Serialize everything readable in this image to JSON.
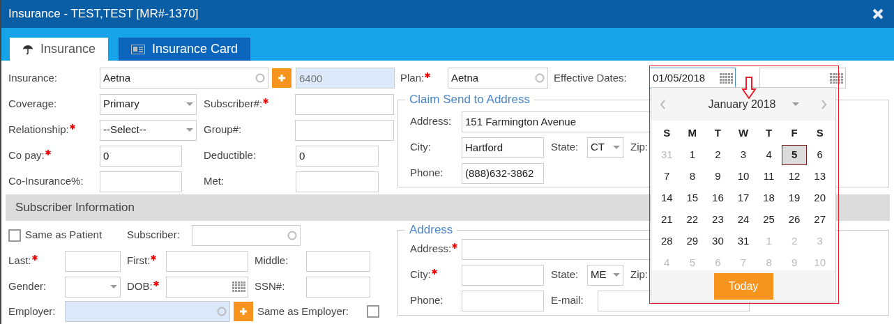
{
  "window": {
    "title": "Insurance - TEST,TEST [MR#-1370]"
  },
  "tabs": [
    {
      "label": "Insurance",
      "kind": "umbrella",
      "selected": true
    },
    {
      "label": "Insurance Card",
      "kind": "card",
      "selected": false
    }
  ],
  "top_row": {
    "insurance": {
      "label": "Insurance:",
      "kind": "lookup",
      "value": "Aetna"
    },
    "code": {
      "kind": "text",
      "value": "6400",
      "highlighted": true
    },
    "plan": {
      "label": "Plan:",
      "required": true,
      "kind": "lookup",
      "value": "Aetna"
    },
    "effective_dates": {
      "label": "Effective Dates:",
      "from": "01/05/2018"
    }
  },
  "policy_fields": [
    [
      {
        "label": "Coverage:",
        "required": false,
        "kind": "select",
        "value": "Primary"
      },
      {
        "label": "Subscriber#:",
        "required": true,
        "kind": "text"
      }
    ],
    [
      {
        "label": "Relationship:",
        "required": true,
        "kind": "select",
        "value": "--Select--"
      },
      {
        "label": "Group#:",
        "required": false,
        "kind": "text"
      }
    ],
    [
      {
        "label": "Co pay:",
        "required": true,
        "kind": "text",
        "value": "0"
      },
      {
        "label": "Deductible:",
        "required": false,
        "kind": "text",
        "value": "0"
      }
    ],
    [
      {
        "label": "Co-Insurance%:",
        "required": false,
        "kind": "text"
      },
      {
        "label": "Met:",
        "required": false,
        "kind": "text"
      }
    ]
  ],
  "claim_address": {
    "legend": "Claim Send to Address",
    "rows": [
      [
        {
          "label": "Address:",
          "required": false,
          "kind": "text",
          "value": "151 Farmington Avenue"
        }
      ],
      [
        {
          "label": "City:",
          "required": false,
          "kind": "text",
          "value": "Hartford"
        },
        {
          "label": "State:",
          "required": false,
          "kind": "select",
          "value": "CT"
        },
        {
          "label": "Zip:",
          "required": false,
          "kind": "none"
        }
      ],
      [
        {
          "label": "Phone:",
          "required": false,
          "kind": "text",
          "value": "(888)632-3862"
        }
      ]
    ]
  },
  "subscriber": {
    "header": "Subscriber Information",
    "same_as_patient": {
      "label": "Same as Patient",
      "checked": false
    },
    "subscriber_lookup": {
      "label": "Subscriber:",
      "kind": "lookup"
    },
    "rows": [
      [
        {
          "label": "Last:",
          "required": true,
          "kind": "text"
        },
        {
          "label": "First:",
          "required": true,
          "kind": "text"
        },
        {
          "label": "Middle:",
          "required": false,
          "kind": "text"
        }
      ],
      [
        {
          "label": "Gender:",
          "required": false,
          "kind": "select"
        },
        {
          "label": "DOB:",
          "required": true,
          "kind": "date"
        },
        {
          "label": "SSN#:",
          "required": false,
          "kind": "text"
        }
      ]
    ],
    "employer": {
      "label": "Employer:",
      "kind": "lookup",
      "highlighted": true
    },
    "same_as_employer": {
      "label": "Same as Employer:",
      "checked": false
    }
  },
  "address": {
    "legend": "Address",
    "rows": [
      [
        {
          "label": "Address:",
          "required": true,
          "kind": "text"
        }
      ],
      [
        {
          "label": "City:",
          "required": true,
          "kind": "text"
        },
        {
          "label": "State:",
          "required": false,
          "kind": "select",
          "value": "ME"
        },
        {
          "label": "Zip:",
          "required": false,
          "kind": "none"
        }
      ],
      [
        {
          "label": "Phone:",
          "required": false,
          "kind": "text"
        },
        {
          "label": "E-mail:",
          "required": false,
          "kind": "text"
        }
      ]
    ]
  },
  "calendar": {
    "month": "January 2018",
    "weekdays": [
      "S",
      "M",
      "T",
      "W",
      "T",
      "F",
      "S"
    ],
    "days": [
      {
        "label": "31",
        "other_month": true,
        "selected": false
      },
      {
        "label": "1",
        "other_month": false,
        "selected": false
      },
      {
        "label": "2",
        "other_month": false,
        "selected": false
      },
      {
        "label": "3",
        "other_month": false,
        "selected": false
      },
      {
        "label": "4",
        "other_month": false,
        "selected": false
      },
      {
        "label": "5",
        "other_month": false,
        "selected": true
      },
      {
        "label": "6",
        "other_month": false,
        "selected": false
      },
      {
        "label": "7",
        "other_month": false,
        "selected": false
      },
      {
        "label": "8",
        "other_month": false,
        "selected": false
      },
      {
        "label": "9",
        "other_month": false,
        "selected": false
      },
      {
        "label": "10",
        "other_month": false,
        "selected": false
      },
      {
        "label": "11",
        "other_month": false,
        "selected": false
      },
      {
        "label": "12",
        "other_month": false,
        "selected": false
      },
      {
        "label": "13",
        "other_month": false,
        "selected": false
      },
      {
        "label": "14",
        "other_month": false,
        "selected": false
      },
      {
        "label": "15",
        "other_month": false,
        "selected": false
      },
      {
        "label": "16",
        "other_month": false,
        "selected": false
      },
      {
        "label": "17",
        "other_month": false,
        "selected": false
      },
      {
        "label": "18",
        "other_month": false,
        "selected": false
      },
      {
        "label": "19",
        "other_month": false,
        "selected": false
      },
      {
        "label": "20",
        "other_month": false,
        "selected": false
      },
      {
        "label": "21",
        "other_month": false,
        "selected": false
      },
      {
        "label": "22",
        "other_month": false,
        "selected": false
      },
      {
        "label": "23",
        "other_month": false,
        "selected": false
      },
      {
        "label": "24",
        "other_month": false,
        "selected": false
      },
      {
        "label": "25",
        "other_month": false,
        "selected": false
      },
      {
        "label": "26",
        "other_month": false,
        "selected": false
      },
      {
        "label": "27",
        "other_month": false,
        "selected": false
      },
      {
        "label": "28",
        "other_month": false,
        "selected": false
      },
      {
        "label": "29",
        "other_month": false,
        "selected": false
      },
      {
        "label": "30",
        "other_month": false,
        "selected": false
      },
      {
        "label": "31",
        "other_month": false,
        "selected": false
      },
      {
        "label": "1",
        "other_month": true,
        "selected": false
      },
      {
        "label": "2",
        "other_month": true,
        "selected": false
      },
      {
        "label": "3",
        "other_month": true,
        "selected": false
      },
      {
        "label": "4",
        "other_month": true,
        "selected": false
      },
      {
        "label": "5",
        "other_month": true,
        "selected": false
      },
      {
        "label": "6",
        "other_month": true,
        "selected": false
      },
      {
        "label": "7",
        "other_month": true,
        "selected": false
      },
      {
        "label": "8",
        "other_month": true,
        "selected": false
      },
      {
        "label": "9",
        "other_month": true,
        "selected": false
      },
      {
        "label": "10",
        "other_month": true,
        "selected": false
      }
    ],
    "today_button": "Today"
  }
}
